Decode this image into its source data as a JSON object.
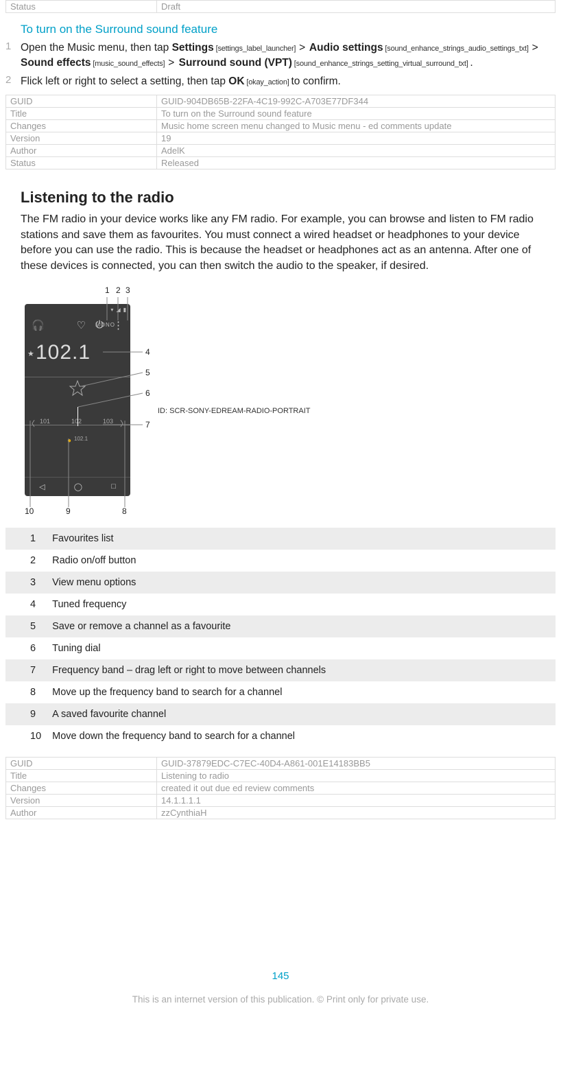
{
  "meta_top": {
    "rows": [
      [
        "Status",
        "Draft"
      ]
    ]
  },
  "section1": {
    "heading": "To turn on the Surround sound feature",
    "step1_num": "1",
    "step1_a": "Open the Music menu, then tap ",
    "step1_settings": "Settings",
    "step1_settings_ann": " [settings_label_launcher] ",
    "step1_gt1": ">",
    "step1_audio": " Audio settings",
    "step1_audio_ann": " [sound_enhance_strings_audio_settings_txt] ",
    "step1_gt2": ">",
    "step1_effects": " Sound effects",
    "step1_effects_ann": " [music_sound_effects] ",
    "step1_gt3": ">",
    "step1_surround": " Surround sound (VPT)",
    "step1_surround_ann": " [sound_enhance_strings_setting_virtual_surround_txt] ",
    "step1_dot": ".",
    "step2_num": "2",
    "step2_a": "Flick left or right to select a setting, then tap ",
    "step2_ok": "OK",
    "step2_ok_ann": " [okay_action] ",
    "step2_b": "to confirm."
  },
  "meta1": {
    "rows": [
      [
        "GUID",
        "GUID-904DB65B-22FA-4C19-992C-A703E77DF344"
      ],
      [
        "Title",
        "To turn on the Surround sound feature"
      ],
      [
        "Changes",
        "Music home screen menu changed to Music menu - ed comments update"
      ],
      [
        "Version",
        "19"
      ],
      [
        "Author",
        "AdelK"
      ],
      [
        "Status",
        "Released"
      ]
    ]
  },
  "radio": {
    "heading": "Listening to the radio",
    "para": "The FM radio in your device works like any FM radio. For example, you can browse and listen to FM radio stations and save them as favourites. You must connect a wired headset or headphones to your device before you can use the radio. This is because the headset or headphones act as an antenna. After one of these devices is connected, you can then switch the audio to the speaker, if desired.",
    "fig_id": "ID: SCR-SONY-EDREAM-RADIO-PORTRAIT",
    "freq": "102.1",
    "mono": "MONO",
    "ch_left": "101",
    "ch_mid": "102",
    "ch_right": "103",
    "fav": "102.1"
  },
  "callouts": {
    "c1": "1",
    "c2": "2",
    "c3": "3",
    "c4": "4",
    "c5": "5",
    "c6": "6",
    "c7": "7",
    "c8": "8",
    "c9": "9",
    "c10": "10"
  },
  "legend": {
    "rows": [
      [
        "1",
        "Favourites list"
      ],
      [
        "2",
        "Radio on/off button"
      ],
      [
        "3",
        "View menu options"
      ],
      [
        "4",
        "Tuned frequency"
      ],
      [
        "5",
        "Save or remove a channel as a favourite"
      ],
      [
        "6",
        "Tuning dial"
      ],
      [
        "7",
        "Frequency band – drag left or right to move between channels"
      ],
      [
        "8",
        "Move up the frequency band to search for a channel"
      ],
      [
        "9",
        "A saved favourite channel"
      ],
      [
        "10",
        "Move down the frequency band to search for a channel"
      ]
    ]
  },
  "meta2": {
    "rows": [
      [
        "GUID",
        "GUID-37879EDC-C7EC-40D4-A861-001E14183BB5"
      ],
      [
        "Title",
        "Listening to radio"
      ],
      [
        "Changes",
        "created it out due ed review comments"
      ],
      [
        "Version",
        "14.1.1.1.1"
      ],
      [
        "Author",
        "zzCynthiaH"
      ]
    ]
  },
  "page_num": "145",
  "footer": "This is an internet version of this publication. © Print only for private use."
}
